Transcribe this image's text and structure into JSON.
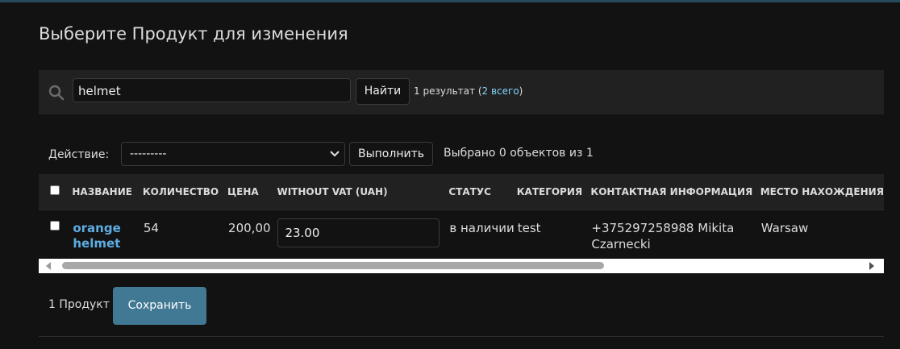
{
  "page_title": "Выберите Продукт для изменения",
  "search": {
    "icon": "search-icon",
    "value": "helmet",
    "button_label": "Найти",
    "result_text": "1 результат (",
    "total_link": "2 всего",
    "result_close": ")"
  },
  "actions": {
    "label": "Действие:",
    "selected": "---------",
    "run_label": "Выполнить",
    "counter": "Выбрано 0 объектов из 1"
  },
  "table": {
    "headers": [
      "Название",
      "Количество",
      "Цена",
      "Without VAT (UAH)",
      "Статус",
      "Категория",
      "Контактная информация",
      "Место нахождения"
    ],
    "rows": [
      {
        "name_line1": "orange",
        "name_line2": "helmet",
        "quantity": "54",
        "price": "200,00",
        "without_vat": "23.00",
        "status": "в наличии",
        "category": "test",
        "contact": "+375297258988 Mikita Czarnecki",
        "location": "Warsaw"
      }
    ]
  },
  "footer": {
    "count": "1 Продукт",
    "save_label": "Сохранить"
  },
  "colors": {
    "background": "#121212",
    "toolbar": "#212121",
    "accent": "#417893",
    "link": "#5dade2",
    "topbar": "#264b5d"
  }
}
